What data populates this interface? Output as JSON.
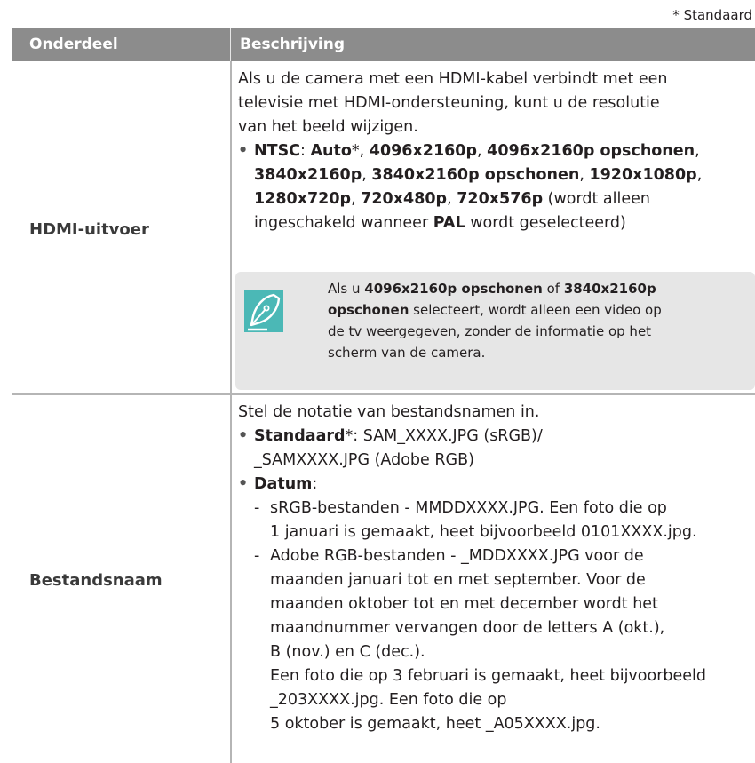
{
  "legend": "* Standaard",
  "header": {
    "col1": "Onderdeel",
    "col2": "Beschrijving"
  },
  "rows": [
    {
      "item": "HDMI-uitvoer",
      "desc": [
        "Als u de camera met een HDMI-kabel verbindt met een",
        "televisie met HDMI-ondersteuning, kunt u de resolutie",
        "van het beeld wijzigen."
      ],
      "bullet": {
        "label": "NTSC",
        "line1_parts": [
          "Auto",
          "*, ",
          "4096x2160p",
          ", ",
          "4096x2160p opschonen",
          ","
        ],
        "line2_parts": [
          "3840x2160p",
          ", ",
          "3840x2160p opschonen",
          ", ",
          "1920x1080p",
          ","
        ],
        "line3_parts": [
          "1280x720p",
          ", ",
          "720x480p",
          ", ",
          "720x576p",
          " (wordt alleen"
        ],
        "line4_parts": [
          "ingeschakeld wanneer ",
          "PAL",
          " wordt geselecteerd)"
        ]
      },
      "note": {
        "icon": "pen-nib-icon",
        "line1_parts": [
          "Als u ",
          "4096x2160p opschonen",
          " of ",
          "3840x2160p"
        ],
        "line2_parts": [
          "opschonen",
          " selecteert, wordt alleen een video op"
        ],
        "line3": "de tv weergegeven, zonder de informatie op het",
        "line4": "scherm van de camera."
      }
    },
    {
      "item": "Bestandsnaam",
      "intro": "Stel de notatie van bestandsnamen in.",
      "bullet1": {
        "label": "Standaard",
        "rest": "*: SAM_XXXX.JPG (sRGB)/",
        "line2": "_SAMXXXX.JPG (Adobe RGB)"
      },
      "bullet2": {
        "label": "Datum",
        "rest": ":"
      },
      "sub1": [
        "sRGB-bestanden - MMDDXXXX.JPG. Een foto die op",
        "1 januari is gemaakt, heet bijvoorbeeld 0101XXXX.jpg."
      ],
      "sub2": [
        "Adobe RGB-bestanden - _MDDXXXX.JPG voor de",
        "maanden januari tot en met september. Voor de",
        "maanden oktober tot en met december wordt het",
        "maandnummer vervangen door de letters A (okt.),",
        "B (nov.) en C (dec.).",
        "Een foto die op 3 februari is gemaakt, heet bijvoorbeeld",
        "_203XXXX.jpg. Een foto die op",
        "5 oktober is gemaakt, heet _A05XXXX.jpg."
      ]
    }
  ],
  "colors": {
    "header_bg": "#8c8c8c",
    "note_bg": "#e6e6e6",
    "icon_bg": "#4bb8b6",
    "rule": "#b5b5b5"
  }
}
